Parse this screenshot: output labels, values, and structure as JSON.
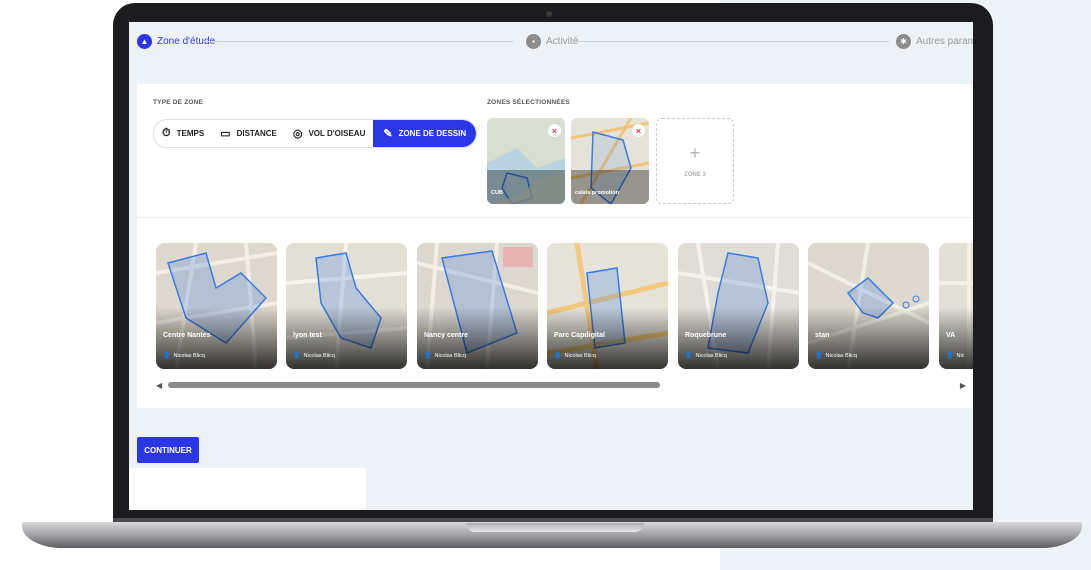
{
  "stepper": {
    "steps": [
      {
        "label": "Zone d'étude",
        "state": "active",
        "icon": "mountain-icon"
      },
      {
        "label": "Activité",
        "state": "idle",
        "icon": "building-icon"
      },
      {
        "label": "Autres param",
        "state": "idle",
        "icon": "settings-icon"
      }
    ]
  },
  "type_zone": {
    "label": "TYPE DE ZONE",
    "options": [
      {
        "label": "TEMPS",
        "icon": "stopwatch-icon"
      },
      {
        "label": "DISTANCE",
        "icon": "ruler-icon"
      },
      {
        "label": "VOL D'OISEAU",
        "icon": "target-icon"
      },
      {
        "label": "ZONE DE DESSIN",
        "icon": "draw-icon",
        "selected": true
      }
    ]
  },
  "selected_zones": {
    "label": "ZONES SÉLECTIONNÉES",
    "zones": [
      {
        "name": "CUB"
      },
      {
        "name": "calais promotion"
      }
    ],
    "add_label": "ZONE 3"
  },
  "gallery": {
    "tiles": [
      {
        "name": "Centre Nantes",
        "author": "Nicolas Blicq"
      },
      {
        "name": "lyon test",
        "author": "Nicolas Blicq"
      },
      {
        "name": "Nancy centre",
        "author": "Nicolas Blicq"
      },
      {
        "name": "Parc Capdigital",
        "author": "Nicolas Blicq"
      },
      {
        "name": "Roquebrune",
        "author": "Nicolas Blicq"
      },
      {
        "name": "stan",
        "author": "Nicolas Blicq"
      },
      {
        "name": "VA",
        "author": "Nic"
      }
    ]
  },
  "actions": {
    "continue_label": "CONTINUER"
  },
  "colors": {
    "primary": "#2b37e6",
    "zone_stroke": "#3b7be0",
    "remove": "#e0413a"
  }
}
